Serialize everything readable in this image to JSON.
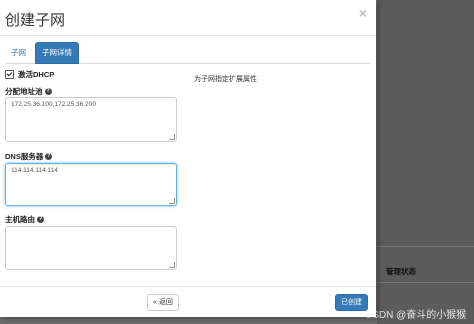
{
  "modal": {
    "title": "创建子网",
    "close_symbol": "×"
  },
  "tabs": [
    {
      "label": "子网",
      "active": false
    },
    {
      "label": "子网详情",
      "active": true
    }
  ],
  "form": {
    "dhcp_label": "激活DHCP",
    "dhcp_checked": true,
    "pool_label": "分配地址池",
    "pool_value": "172.25.36.100,172.25.36.200",
    "dns_label": "DNS服务器",
    "dns_value": "114.114.114.114",
    "routes_label": "主机路由",
    "routes_value": "",
    "help_symbol": "?"
  },
  "side_help": "为子网指定扩展属性",
  "footer": {
    "back_label": "« 返回",
    "create_label": "已创建"
  },
  "background": {
    "column_header": "管理状态",
    "watermark": "CSDN @奋斗的小猴猴"
  }
}
